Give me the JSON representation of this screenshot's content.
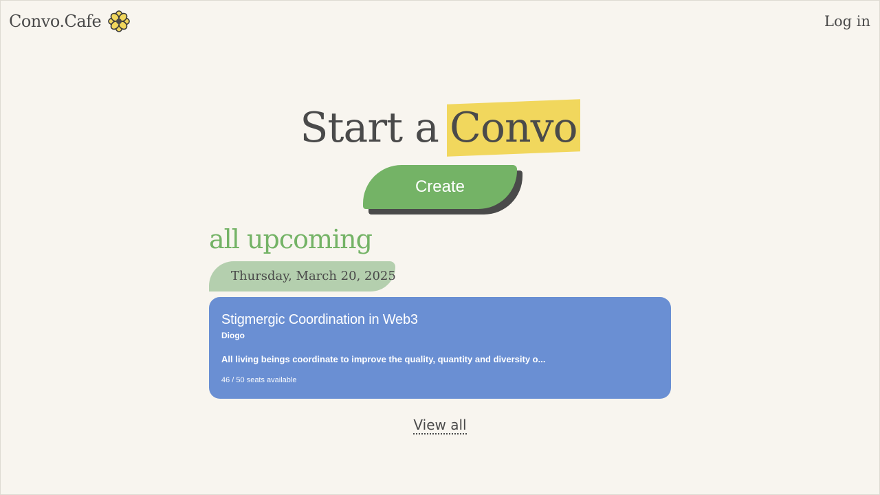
{
  "header": {
    "brand_name": "Convo.Cafe",
    "logo_icon": "flower-icon",
    "login_label": "Log in"
  },
  "hero": {
    "title_prefix": "Start a",
    "title_highlight": "Convo",
    "create_label": "Create"
  },
  "upcoming": {
    "heading": "all upcoming",
    "date_label": "Thursday, March 20, 2025",
    "events": [
      {
        "title": "Stigmergic Coordination in Web3",
        "host": "Diogo",
        "description": "All living beings coordinate to improve the quality, quantity and diversity o...",
        "seats": "46 / 50 seats available"
      }
    ],
    "view_all_label": "View all"
  },
  "colors": {
    "background": "#f8f5ef",
    "text": "#4a4a4a",
    "accent_green": "#74b366",
    "date_pill": "#b4cfae",
    "highlight_yellow": "#f1d75d",
    "card_blue": "#6a8fd3"
  }
}
